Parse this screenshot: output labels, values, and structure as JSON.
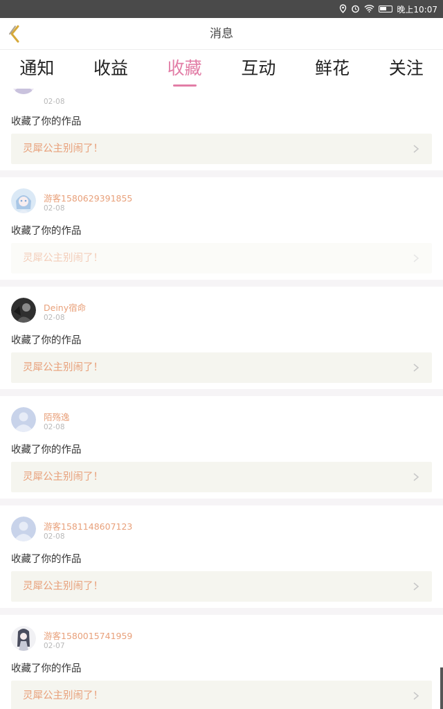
{
  "status_bar": {
    "time_label": "晚上10:07"
  },
  "header": {
    "title": "消息"
  },
  "tabs": [
    {
      "label": "通知",
      "active": false
    },
    {
      "label": "收益",
      "active": false
    },
    {
      "label": "收藏",
      "active": true
    },
    {
      "label": "互动",
      "active": false
    },
    {
      "label": "鲜花",
      "active": false
    },
    {
      "label": "关注",
      "active": false
    }
  ],
  "colors": {
    "accent": "#e27da6",
    "username": "#e8a07a",
    "work_bg": "#f5f5ef"
  },
  "items": [
    {
      "name": "",
      "date": "02-08",
      "action": "收藏了你的作品",
      "work_title": "灵犀公主别闹了！",
      "avatar": "anime-girl-avatar"
    },
    {
      "name": "游客1580629391855",
      "date": "02-08",
      "action": "收藏了你的作品",
      "work_title": "灵犀公主别闹了！",
      "avatar": "anime-girl-avatar"
    },
    {
      "name": "Deiny宿命",
      "date": "02-08",
      "action": "收藏了你的作品",
      "work_title": "灵犀公主别闹了！",
      "avatar": "dark-photo-avatar"
    },
    {
      "name": "陌殇逸",
      "date": "02-08",
      "action": "收藏了你的作品",
      "work_title": "灵犀公主别闹了！",
      "avatar": "default-avatar"
    },
    {
      "name": "游客1581148607123",
      "date": "02-08",
      "action": "收藏了你的作品",
      "work_title": "灵犀公主别闹了！",
      "avatar": "default-avatar"
    },
    {
      "name": "游客1580015741959",
      "date": "02-07",
      "action": "收藏了你的作品",
      "work_title": "灵犀公主别闹了！",
      "avatar": "anime-girl-avatar"
    }
  ]
}
